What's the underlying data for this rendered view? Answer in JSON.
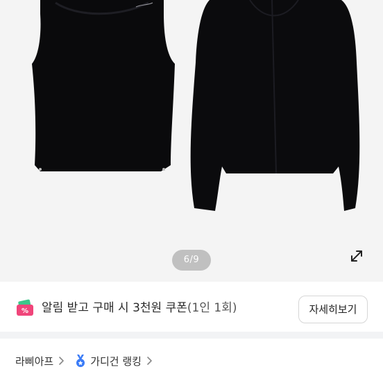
{
  "gallery": {
    "page_indicator": "6/9",
    "expand_icon": "expand-diagonal-icon",
    "background": "#f4f4f4"
  },
  "coupon": {
    "icon": "coupon-ticket-icon",
    "text": "알림 받고 구매 시 3천원 쿠폰",
    "sub": "(1인 1회)",
    "detail_label": "자세히보기"
  },
  "breadcrumb": {
    "items": [
      {
        "label": "라삐아프",
        "icon": ""
      },
      {
        "label": "가디건 랭킹",
        "icon": "medal-icon"
      }
    ]
  },
  "colors": {
    "accent_pink": "#f0457a",
    "accent_green": "#3cc88a",
    "medal_blue": "#3a7bf7"
  }
}
